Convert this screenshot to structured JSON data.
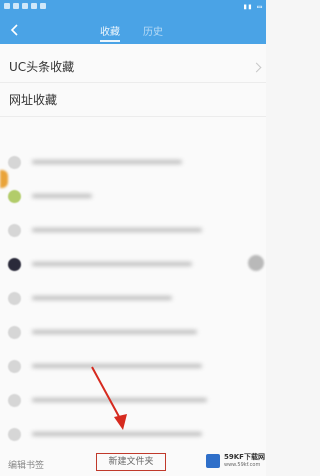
{
  "nav": {
    "tabs": [
      "收藏",
      "历史"
    ]
  },
  "menu": [
    "UC头条收藏",
    "网址收藏"
  ],
  "bottom": {
    "edit": "编辑书签",
    "new_folder": "新建文件夹"
  },
  "watermark": {
    "title": "59KF下载网",
    "sub": "www.59kf.com"
  },
  "colors": {
    "header": "#4aa3e6",
    "highlight": "#c0392b"
  },
  "icons": [
    "back-icon",
    "chevron-right-icon",
    "annotation-arrow"
  ]
}
